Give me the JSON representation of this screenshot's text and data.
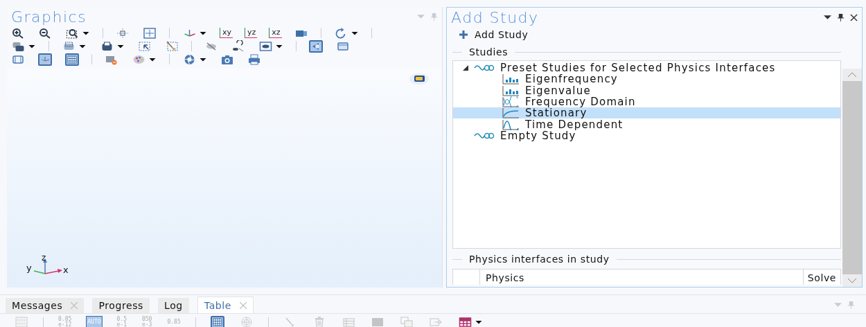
{
  "graphics": {
    "title": "Graphics",
    "toolbar": [
      [
        {
          "kind": "zoom-in",
          "on": false,
          "dropdown": false
        },
        {
          "kind": "zoom-out",
          "on": false,
          "dropdown": false
        },
        {
          "kind": "zoom-box",
          "on": false,
          "dropdown": true
        },
        {
          "kind": "separator"
        },
        {
          "kind": "zoom-extents",
          "on": false,
          "dropdown": false
        },
        {
          "kind": "zoom-fit",
          "on": false,
          "dropdown": false
        },
        {
          "kind": "separator"
        },
        {
          "kind": "axes",
          "on": false,
          "dropdown": true
        },
        {
          "kind": "plane",
          "label": "xy",
          "on": false,
          "dropdown": false
        },
        {
          "kind": "plane",
          "label": "yz",
          "on": false,
          "dropdown": false
        },
        {
          "kind": "plane",
          "label": "xz",
          "on": false,
          "dropdown": false
        },
        {
          "kind": "camera-view",
          "on": false,
          "dropdown": false
        },
        {
          "kind": "separator"
        },
        {
          "kind": "rotate",
          "on": false,
          "dropdown": true
        },
        {
          "kind": "separator"
        }
      ],
      [
        {
          "kind": "layers",
          "on": false,
          "dropdown": true
        },
        {
          "kind": "separator"
        },
        {
          "kind": "select-shape",
          "on": false,
          "dropdown": true
        },
        {
          "kind": "select-dark",
          "on": false,
          "dropdown": true
        },
        {
          "kind": "select-box",
          "on": false,
          "dropdown": false
        },
        {
          "kind": "broom",
          "on": false,
          "dropdown": false
        },
        {
          "kind": "separator"
        },
        {
          "kind": "hide",
          "on": false,
          "dropdown": false
        },
        {
          "kind": "reset-hiding",
          "on": false,
          "dropdown": false
        },
        {
          "kind": "eye-view",
          "on": false,
          "dropdown": true
        },
        {
          "kind": "separator"
        },
        {
          "kind": "transparency",
          "on": true,
          "dropdown": false
        },
        {
          "kind": "wireframe",
          "on": false,
          "dropdown": false
        }
      ],
      [
        {
          "kind": "box",
          "on": false,
          "dropdown": false
        },
        {
          "kind": "grid-axes",
          "on": true,
          "dropdown": false
        },
        {
          "kind": "grid-table",
          "on": true,
          "dropdown": false
        },
        {
          "kind": "separator"
        },
        {
          "kind": "material-remove",
          "on": false,
          "dropdown": false
        },
        {
          "kind": "palette",
          "on": false,
          "dropdown": true
        },
        {
          "kind": "separator"
        },
        {
          "kind": "aperture",
          "on": false,
          "dropdown": true
        },
        {
          "kind": "camera",
          "on": false,
          "dropdown": false
        },
        {
          "kind": "printer",
          "on": false,
          "dropdown": false
        }
      ]
    ],
    "axis_labels": [
      "y",
      "z",
      "x"
    ]
  },
  "add_study": {
    "title": "Add Study",
    "add_button": "Add Study",
    "studies_heading": "Studies",
    "tree": [
      {
        "label": "Preset Studies for Selected Physics Interfaces",
        "kind": "group",
        "expanded": true,
        "selected": false,
        "children": [
          {
            "label": "Eigenfrequency",
            "kind": "eigen",
            "selected": false
          },
          {
            "label": "Eigenvalue",
            "kind": "eigen",
            "selected": false
          },
          {
            "label": "Frequency Domain",
            "kind": "frequency",
            "selected": false
          },
          {
            "label": "Stationary",
            "kind": "stationary",
            "selected": true
          },
          {
            "label": "Time Dependent",
            "kind": "time",
            "selected": false
          }
        ]
      },
      {
        "label": "Empty Study",
        "kind": "group",
        "selected": false
      }
    ],
    "physics_heading": "Physics interfaces in study",
    "columns": [
      "Physics",
      "Solve"
    ]
  },
  "bottom_tabs": [
    {
      "label": "Messages",
      "selected": false,
      "closable": true
    },
    {
      "label": "Progress",
      "selected": false,
      "closable": false
    },
    {
      "label": "Log",
      "selected": false,
      "closable": false
    },
    {
      "label": "Table",
      "selected": true,
      "closable": true
    }
  ],
  "bottom_toolbar": [
    {
      "kind": "table-settings",
      "on": false,
      "disabled": true
    },
    {
      "kind": "separator"
    },
    {
      "kind": "number",
      "lines": [
        "0.85",
        "e-12"
      ],
      "on": false,
      "disabled": true
    },
    {
      "kind": "number",
      "lines": [
        "AUTO"
      ],
      "on": true,
      "disabled": false
    },
    {
      "kind": "number",
      "lines": [
        "0.5",
        "e-1"
      ],
      "on": false,
      "disabled": true
    },
    {
      "kind": "number",
      "lines": [
        "050",
        "e-3"
      ],
      "on": false,
      "disabled": true
    },
    {
      "kind": "number",
      "lines": [
        "0.85"
      ],
      "on": false,
      "disabled": true
    },
    {
      "kind": "separator"
    },
    {
      "kind": "grid-table",
      "on": true,
      "disabled": false
    },
    {
      "kind": "polar",
      "on": false,
      "disabled": true
    },
    {
      "kind": "separator"
    },
    {
      "kind": "brush",
      "on": false,
      "disabled": true
    },
    {
      "kind": "trash",
      "on": false,
      "disabled": true
    },
    {
      "kind": "table-rows",
      "on": false,
      "disabled": true
    },
    {
      "kind": "block",
      "on": false,
      "disabled": true
    },
    {
      "kind": "copy",
      "on": false,
      "disabled": true
    },
    {
      "kind": "export",
      "on": false,
      "disabled": true
    },
    {
      "kind": "colored-table",
      "on": false,
      "disabled": false,
      "dropdown": true
    }
  ]
}
